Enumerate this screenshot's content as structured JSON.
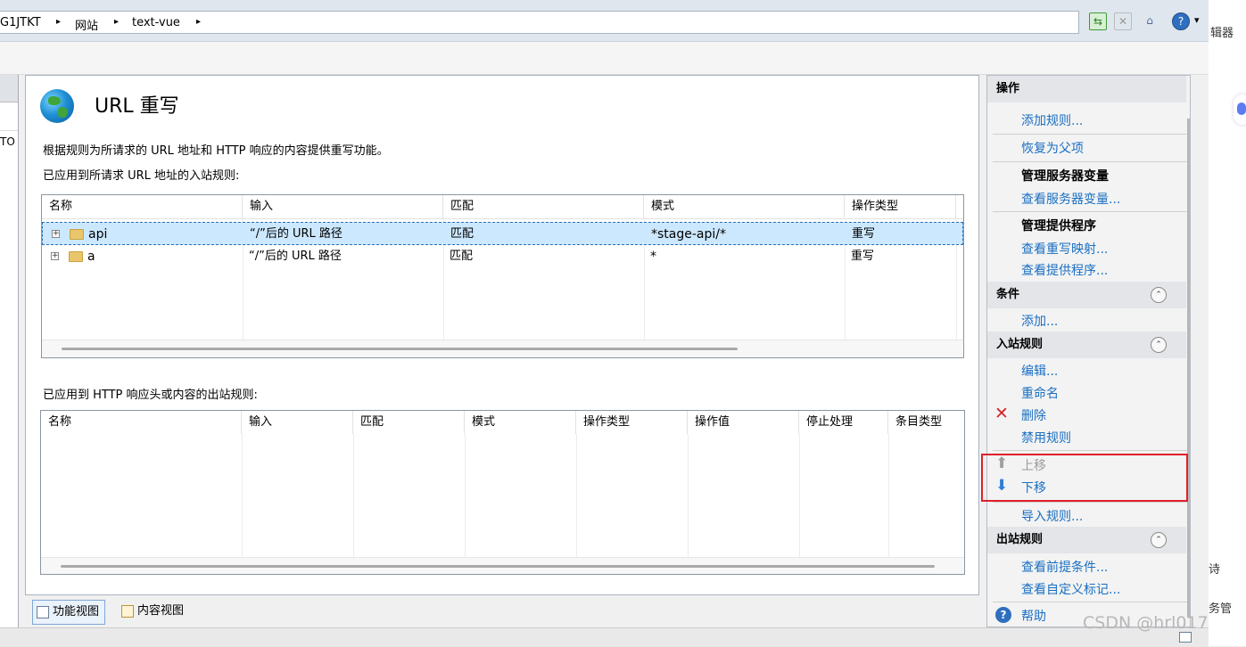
{
  "breadcrumb": {
    "items": [
      "G1JTKT",
      "网站",
      "text-vue"
    ],
    "separator": "▸"
  },
  "toolbar": {
    "icons": [
      "connect-icon",
      "stop-icon",
      "home-icon",
      "help-icon"
    ],
    "help_dropdown": "▾"
  },
  "edge": {
    "top_text": "辑器",
    "mid_text": "诗",
    "bottom_text": "务管",
    "left_text": "TO"
  },
  "page": {
    "title": "URL 重写",
    "description": "根据规则为所请求的 URL 地址和 HTTP 响应的内容提供重写功能。",
    "inbound_label": "已应用到所请求 URL 地址的入站规则:",
    "outbound_label": "已应用到 HTTP 响应头或内容的出站规则:"
  },
  "inbound_table": {
    "columns": [
      "名称",
      "输入",
      "匹配",
      "模式",
      "操作类型"
    ],
    "rows": [
      {
        "name": "api",
        "input": "“/”后的 URL 路径",
        "match": "匹配",
        "pattern": "*stage-api/*",
        "action": "重写",
        "selected": true
      },
      {
        "name": "a",
        "input": "“/”后的 URL 路径",
        "match": "匹配",
        "pattern": "*",
        "action": "重写",
        "selected": false
      }
    ]
  },
  "outbound_table": {
    "columns": [
      "名称",
      "输入",
      "匹配",
      "模式",
      "操作类型",
      "操作值",
      "停止处理",
      "条目类型"
    ]
  },
  "view_tabs": {
    "feature_view": "功能视图",
    "content_view": "内容视图"
  },
  "actions": {
    "header": "操作",
    "add_rule": "添加规则...",
    "revert_parent": "恢复为父项",
    "manage_server_vars": "管理服务器变量",
    "view_server_vars": "查看服务器变量...",
    "manage_providers": "管理提供程序",
    "view_rewrite_maps": "查看重写映射...",
    "view_providers": "查看提供程序...",
    "conditions_header": "条件",
    "conditions_add": "添加...",
    "inbound_header": "入站规则",
    "edit": "编辑...",
    "rename": "重命名",
    "delete": "删除",
    "disable_rule": "禁用规则",
    "move_up": "上移",
    "move_down": "下移",
    "import_rules": "导入规则...",
    "outbound_header": "出站规则",
    "view_preconditions": "查看前提条件...",
    "view_custom_tags": "查看自定义标记...",
    "help": "帮助"
  },
  "watermark": "CSDN @hrl017",
  "colors": {
    "link": "#1a6fc2",
    "selection": "#cce8ff",
    "highlight_box": "#e0202a",
    "delete_icon": "#d9262c",
    "move_down_icon": "#2f7fd6"
  }
}
